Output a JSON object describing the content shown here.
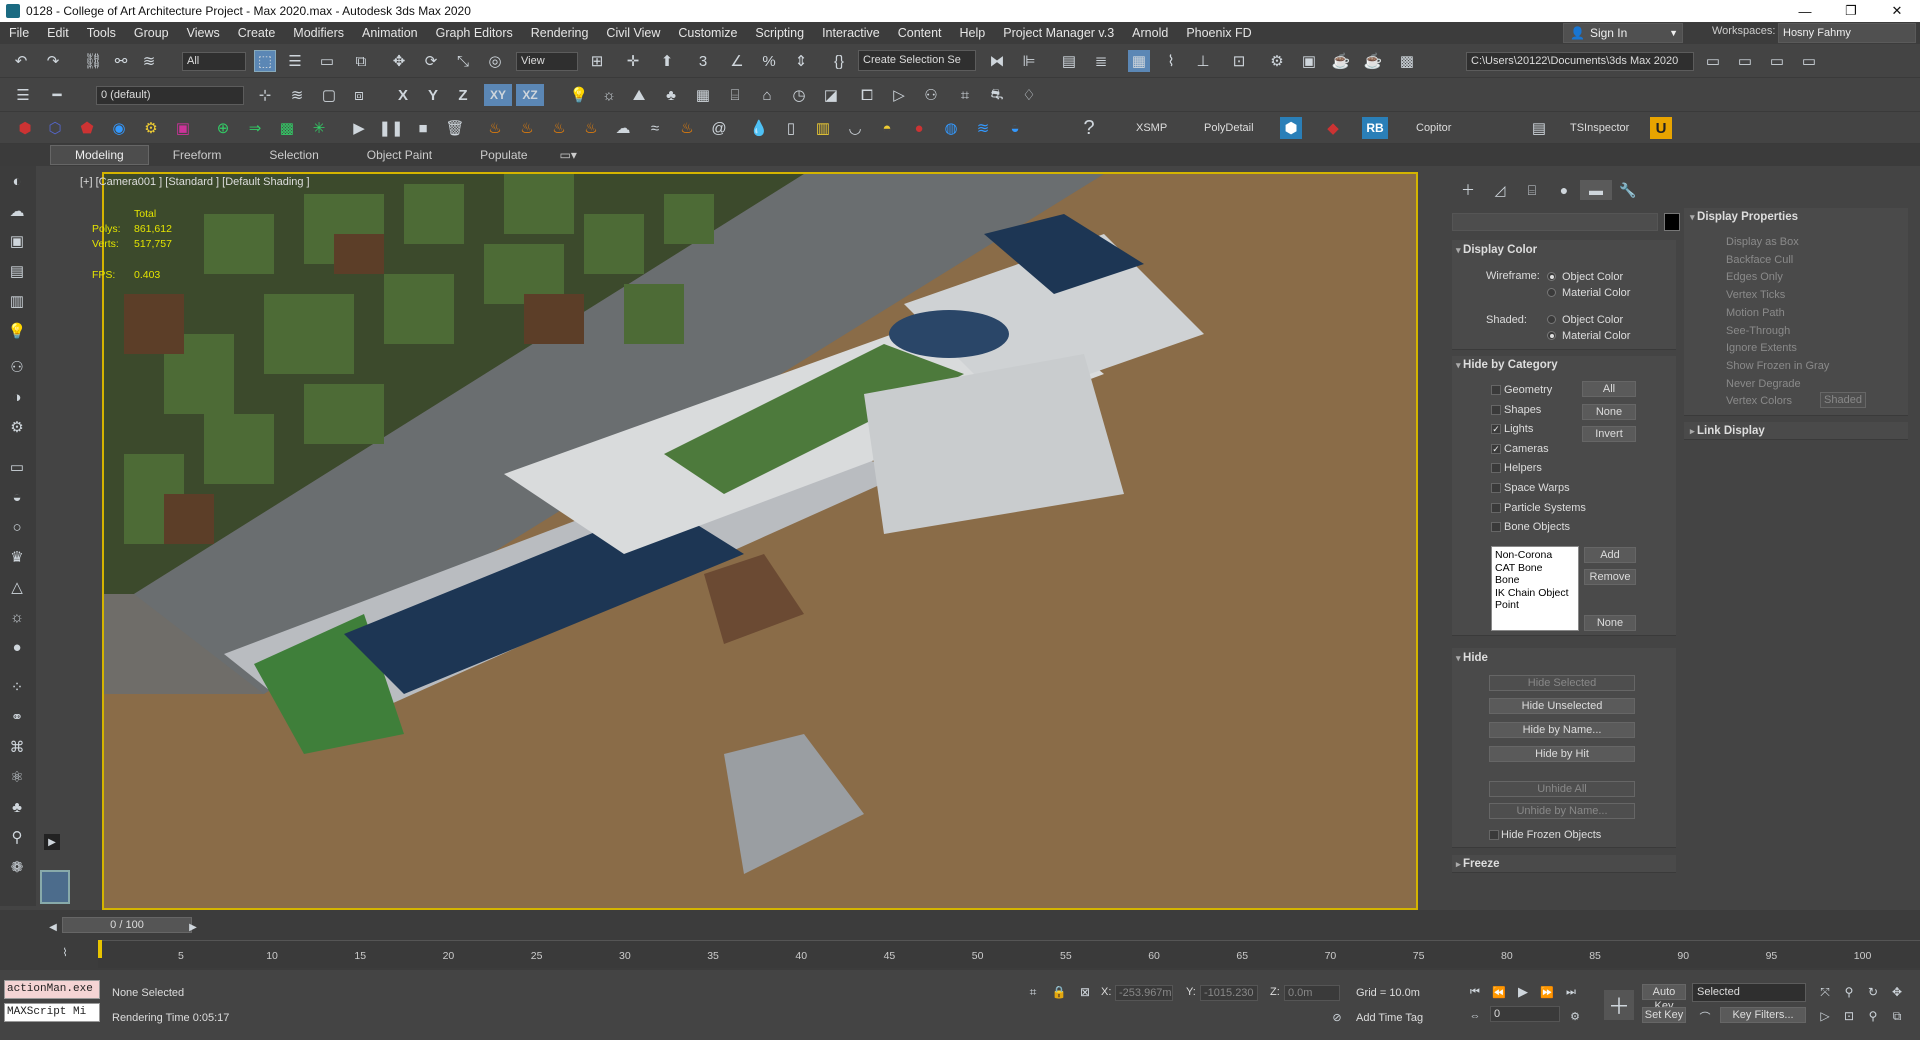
{
  "window": {
    "title": "0128 - College of Art Architecture Project - Max 2020.max - Autodesk 3ds Max 2020",
    "minimize": "—",
    "restore": "❐",
    "close": "✕"
  },
  "menu": [
    "File",
    "Edit",
    "Tools",
    "Group",
    "Views",
    "Create",
    "Modifiers",
    "Animation",
    "Graph Editors",
    "Rendering",
    "Civil View",
    "Customize",
    "Scripting",
    "Interactive",
    "Content",
    "Help",
    "Project Manager v.3",
    "Arnold",
    "Phoenix FD"
  ],
  "signin": "Sign In",
  "workspace": {
    "label": "Workspaces:",
    "value": "Hosny Fahmy"
  },
  "toolbar": {
    "filter": "All",
    "refcoord": "View",
    "selset": "Create Selection Se",
    "path": "C:\\Users\\20122\\Documents\\3ds Max 2020",
    "layer": "0 (default)",
    "x": "X",
    "y": "Y",
    "z": "Z",
    "xy": "XY",
    "xz": "XZ",
    "xsmp": "XSMP",
    "polydetail": "PolyDetail",
    "rb": "RB",
    "copitor": "Copitor",
    "tsinspector": "TSInspector",
    "help": "?"
  },
  "ribbon": [
    "Modeling",
    "Freeform",
    "Selection",
    "Object Paint",
    "Populate"
  ],
  "viewport": {
    "label": "[+] [Camera001 ] [Standard ] [Default Shading ]",
    "stats": {
      "total": "Total",
      "polys_label": "Polys:",
      "polys": "861,612",
      "verts_label": "Verts:",
      "verts": "517,757",
      "fps_label": "FPS:",
      "fps": "0.403"
    }
  },
  "display": {
    "display_color": {
      "title": "Display Color",
      "wireframe": "Wireframe:",
      "shaded": "Shaded:",
      "object_color": "Object Color",
      "material_color": "Material Color",
      "wire_selected": "Object Color",
      "shaded_selected": "Material Color"
    },
    "hide_by_category": {
      "title": "Hide by Category",
      "items": [
        {
          "label": "Geometry",
          "checked": false
        },
        {
          "label": "Shapes",
          "checked": false
        },
        {
          "label": "Lights",
          "checked": true
        },
        {
          "label": "Cameras",
          "checked": true
        },
        {
          "label": "Helpers",
          "checked": false
        },
        {
          "label": "Space Warps",
          "checked": false
        },
        {
          "label": "Particle Systems",
          "checked": false
        },
        {
          "label": "Bone Objects",
          "checked": false
        }
      ],
      "all": "All",
      "none": "None",
      "invert": "Invert",
      "list": [
        "Non-Corona",
        "CAT Bone",
        "Bone",
        "IK Chain Object",
        "Point"
      ],
      "add": "Add",
      "remove": "Remove",
      "none2": "None"
    },
    "hide": {
      "title": "Hide",
      "hide_selected": "Hide Selected",
      "hide_unselected": "Hide Unselected",
      "hide_by_name": "Hide by Name...",
      "hide_by_hit": "Hide by Hit",
      "unhide_all": "Unhide All",
      "unhide_by_name": "Unhide by Name...",
      "hide_frozen": "Hide Frozen Objects"
    },
    "freeze": {
      "title": "Freeze"
    },
    "display_properties": {
      "title": "Display Properties",
      "items": [
        "Display as Box",
        "Backface Cull",
        "Edges Only",
        "Vertex Ticks",
        "Motion Path",
        "See-Through",
        "Ignore Extents",
        "Show Frozen in Gray",
        "Never Degrade",
        "Vertex Colors"
      ],
      "shaded": "Shaded"
    },
    "link_display": {
      "title": "Link Display"
    }
  },
  "timeline": {
    "slider": "0 / 100",
    "ticks": [
      "5",
      "10",
      "15",
      "20",
      "25",
      "30",
      "35",
      "40",
      "45",
      "50",
      "55",
      "60",
      "65",
      "70",
      "75",
      "80",
      "85",
      "90",
      "95",
      "100"
    ]
  },
  "status": {
    "macro1": "actionMan.exe",
    "macro2": "MAXScript Mi",
    "selection": "None Selected",
    "render_time": "Rendering Time  0:05:17",
    "x_label": "X:",
    "x": "-253.967m",
    "y_label": "Y:",
    "y": "-1015.230",
    "z_label": "Z:",
    "z": "0.0m",
    "grid": "Grid = 10.0m",
    "add_time_tag": "Add Time Tag",
    "auto_key": "Auto Key",
    "set_key": "Set Key",
    "selected": "Selected",
    "key_filters": "Key Filters...",
    "frame": "0"
  }
}
